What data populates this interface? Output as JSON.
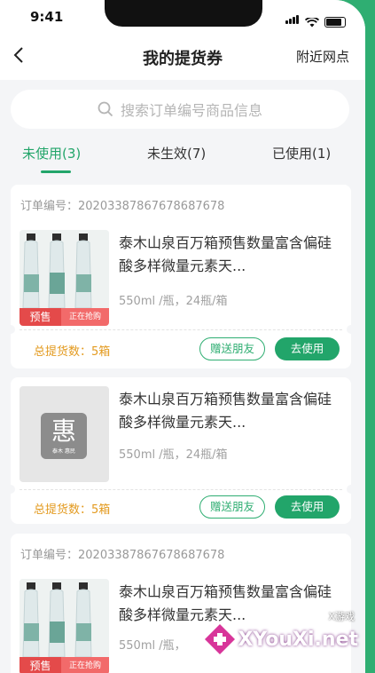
{
  "status_bar": {
    "time": "9:41"
  },
  "header": {
    "title": "我的提货券",
    "right_link": "附近网点"
  },
  "search": {
    "placeholder": "搜索订单编号商品信息"
  },
  "tabs": [
    {
      "label": "未使用(3)",
      "active": true
    },
    {
      "label": "未生效(7)",
      "active": false
    },
    {
      "label": "已使用(1)",
      "active": false
    }
  ],
  "colors": {
    "accent": "#22a56a",
    "warning": "#e39a1f",
    "presale": "#e44a4a"
  },
  "vouchers": [
    {
      "order_no": "订单编号：20203387867678687678",
      "product_name": "泰木山泉百万箱预售数量富含偏硅酸多样微量元素天...",
      "spec": "550ml /瓶，24瓶/箱",
      "presale_tag": "预售",
      "presale_status": "正在抢购",
      "total": "总提货数：5箱",
      "gift_label": "赠送朋友",
      "use_label": "去使用"
    },
    {
      "product_name": "泰木山泉百万箱预售数量富含偏硅酸多样微量元素天...",
      "spec": "550ml /瓶，24瓶/箱",
      "placeholder_char": "惠",
      "placeholder_caption": "泰木 惠民",
      "total": "总提货数：5箱",
      "gift_label": "赠送朋友",
      "use_label": "去使用"
    },
    {
      "order_no": "订单编号：20203387867678687678",
      "product_name": "泰木山泉百万箱预售数量富含偏硅酸多样微量元素天...",
      "spec": "550ml /瓶，",
      "presale_tag": "预售",
      "presale_status": "正在抢购"
    }
  ],
  "watermark": {
    "text": "XYouXi.net",
    "small": "X游戏"
  }
}
